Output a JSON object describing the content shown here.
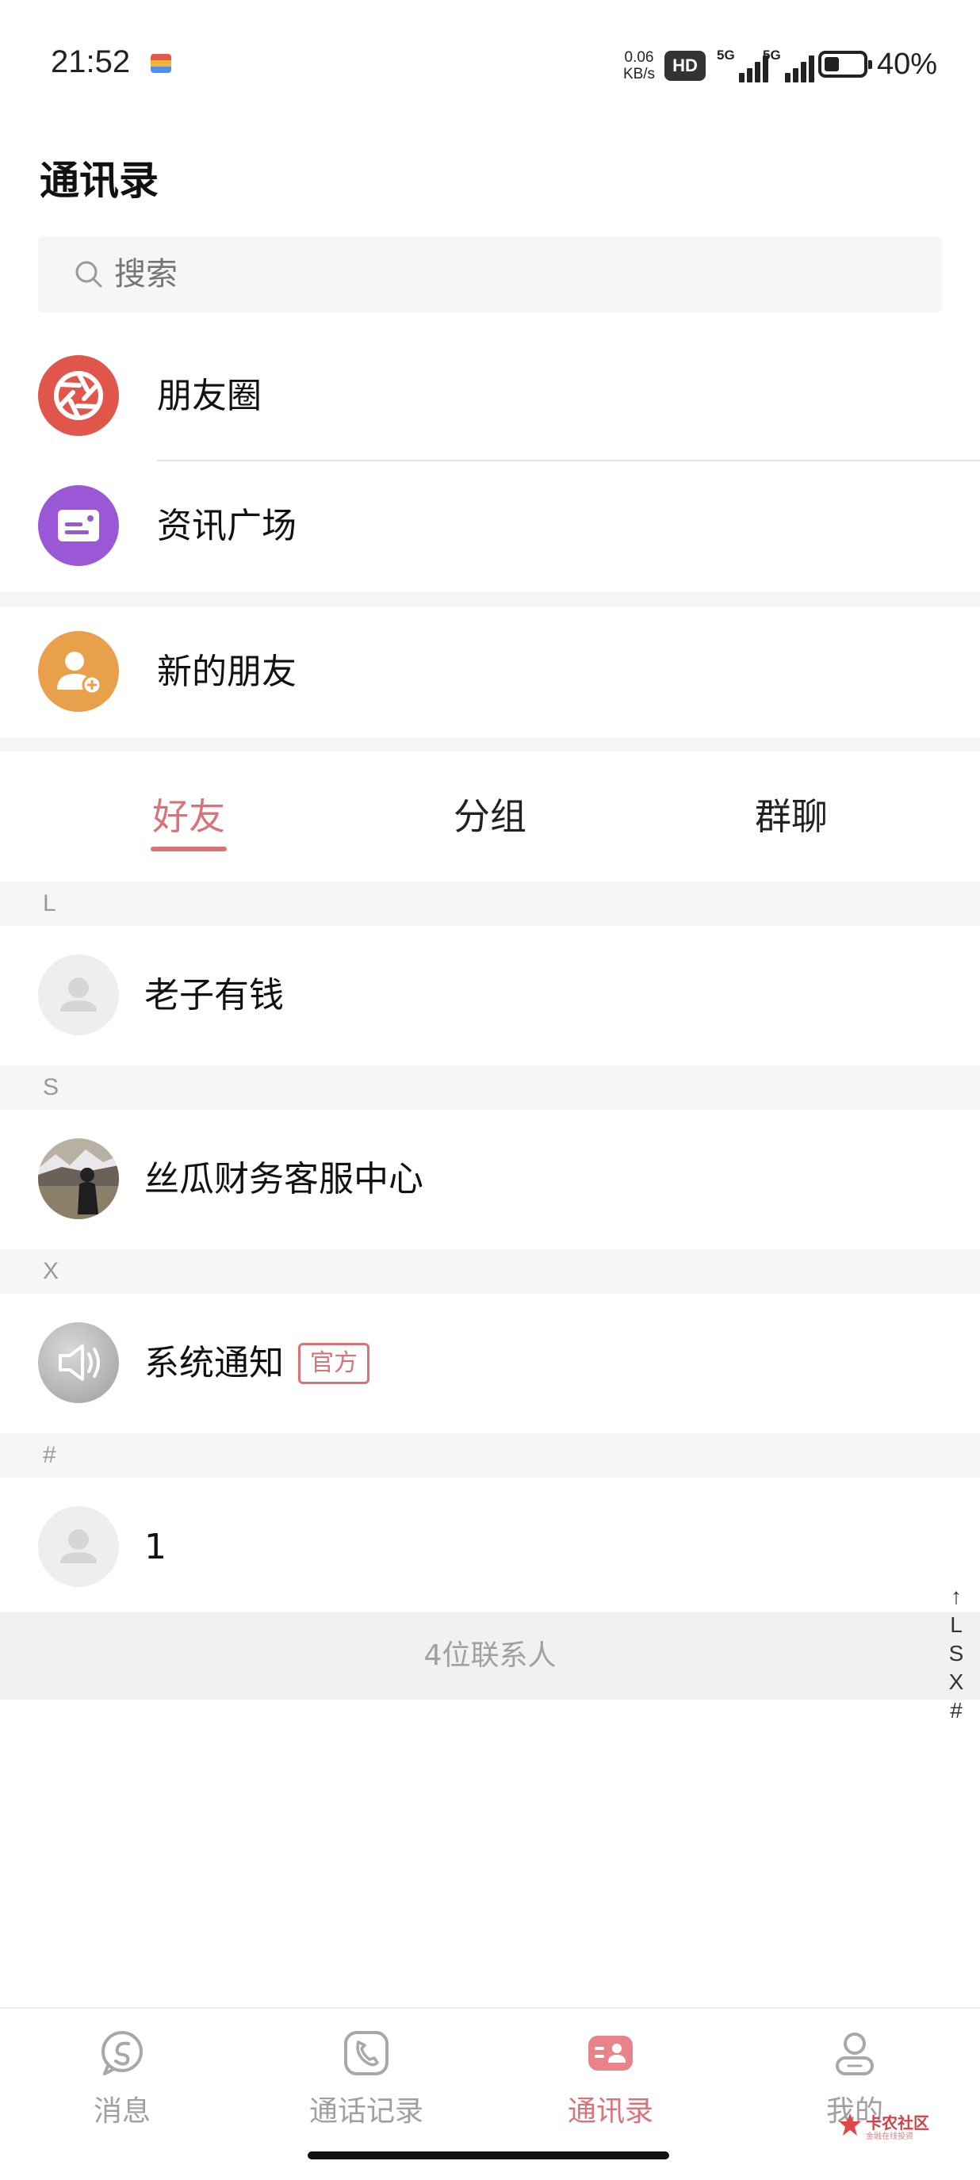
{
  "status_bar": {
    "time": "21:52",
    "net_speed_value": "0.06",
    "net_speed_unit": "KB/s",
    "hd_label": "HD",
    "signal_1_label": "5G",
    "signal_2_label": "5G",
    "battery_level": 0.4,
    "battery_percent": "40%"
  },
  "header": {
    "title": "通讯录"
  },
  "search": {
    "placeholder": "搜索"
  },
  "entries": [
    {
      "label": "朋友圈",
      "icon": "aperture-icon",
      "color": "#e0564a"
    },
    {
      "label": "资讯广场",
      "icon": "news-card-icon",
      "color": "#9a58d6"
    },
    {
      "label": "新的朋友",
      "icon": "add-user-icon",
      "color": "#e9a04a"
    }
  ],
  "tabs": [
    {
      "label": "好友",
      "active": true
    },
    {
      "label": "分组",
      "active": false
    },
    {
      "label": "群聊",
      "active": false
    }
  ],
  "contacts": [
    {
      "section": "L",
      "name": "老子有钱",
      "avatar": "default-avatar-icon"
    },
    {
      "section": "S",
      "name": "丝瓜财务客服中心",
      "avatar": "photo-avatar"
    },
    {
      "section": "X",
      "name": "系统通知",
      "badge": "官方",
      "avatar": "speaker-icon"
    },
    {
      "section": "#",
      "name": "1",
      "avatar": "default-avatar-icon"
    }
  ],
  "contact_count": "4位联系人",
  "alpha_index": [
    "↑",
    "L",
    "S",
    "X",
    "#"
  ],
  "bottom_nav": [
    {
      "label": "消息",
      "icon": "message-icon",
      "active": false
    },
    {
      "label": "通话记录",
      "icon": "phone-icon",
      "active": false
    },
    {
      "label": "通讯录",
      "icon": "contacts-icon",
      "active": true
    },
    {
      "label": "我的",
      "icon": "user-icon",
      "active": false
    }
  ],
  "watermark": {
    "title": "卡农社区",
    "subtitle": "金融在线投资"
  },
  "colors": {
    "accent": "#d9737a",
    "section_bg": "#f6f6f6",
    "muted_text": "#a0a0a0"
  }
}
